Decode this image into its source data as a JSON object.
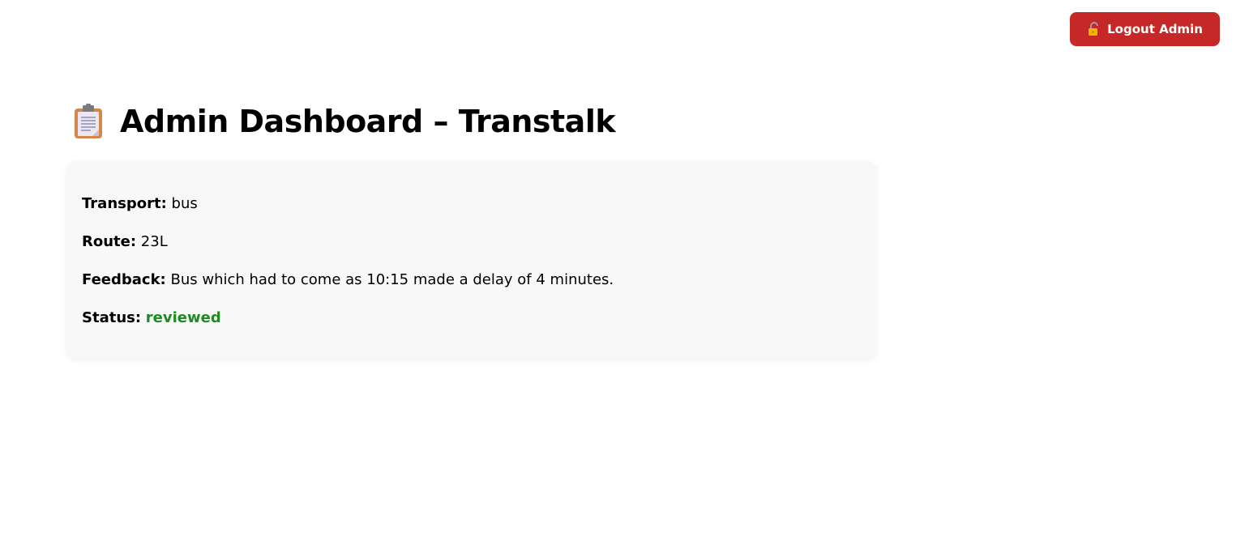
{
  "header": {
    "logout_label": "Logout Admin",
    "logout_icon": "unlocked-padlock-icon",
    "logout_color": "#c62828"
  },
  "page": {
    "title": "Admin Dashboard – Transtalk",
    "title_icon": "clipboard-icon"
  },
  "feedback": {
    "transport_label": "Transport:",
    "transport_value": "bus",
    "route_label": "Route:",
    "route_value": "23L",
    "feedback_label": "Feedback:",
    "feedback_value": "Bus which had to come as 10:15 made a delay of 4 minutes.",
    "status_label": "Status:",
    "status_value": "reviewed",
    "status_color": "#1e8b1e"
  }
}
